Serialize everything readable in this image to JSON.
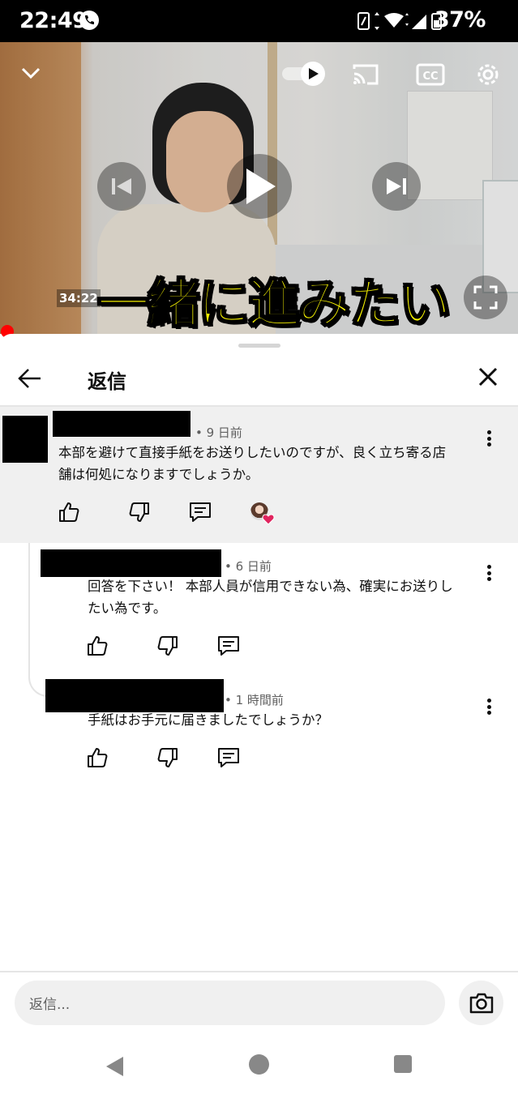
{
  "status_bar": {
    "time": "22:49",
    "battery": "37%",
    "icons": [
      "call-icon",
      "nfc-icon",
      "data-arrows-icon",
      "wifi-icon",
      "signal-icon",
      "battery-icon"
    ]
  },
  "video": {
    "caption": "一緒に進みたい",
    "timestamp": "34:22",
    "controls": [
      "collapse-icon",
      "autoplay-toggle",
      "cast-icon",
      "captions-icon",
      "settings-icon",
      "previous-icon",
      "play-icon",
      "next-icon",
      "fullscreen-icon"
    ]
  },
  "sheet": {
    "title": "返信"
  },
  "comments": [
    {
      "time": "• 9 日前",
      "text_line1": "本部を避けて直接手紙をお送りしたいのですが、良く立ち寄る店",
      "text_line2": "舗は何処になりますでしょうか。"
    },
    {
      "time": "• 6 日前",
      "text_line1": "回答を下さい！ 本部人員が信用できない為、確実にお送りし",
      "text_line2": "たい為です。"
    },
    {
      "time": "• 1 時間前",
      "text_line1": "手紙はお手元に届きましたでしょうか？"
    }
  ],
  "reply_box": {
    "placeholder": "返信..."
  },
  "colors": {
    "highlight_bg": "#f0f0f0",
    "caption_yellow": "#f4f000",
    "progress_red": "#ff0000",
    "heart_red": "#e0245e"
  }
}
